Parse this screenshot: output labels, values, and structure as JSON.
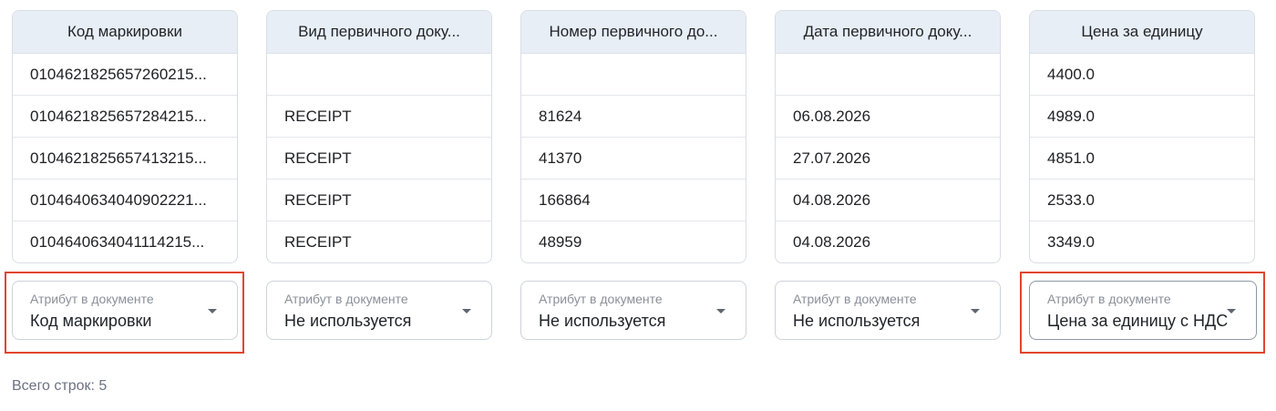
{
  "columns": [
    {
      "header": "Код маркировки",
      "cells": [
        "0104621825657260215...",
        "0104621825657284215...",
        "0104621825657413215...",
        "0104640634040902221...",
        "0104640634041114215..."
      ],
      "select": {
        "label": "Атрибут в документе",
        "value": "Код маркировки"
      }
    },
    {
      "header": "Вид первичного доку...",
      "cells": [
        "",
        "RECEIPT",
        "RECEIPT",
        "RECEIPT",
        "RECEIPT"
      ],
      "select": {
        "label": "Атрибут в документе",
        "value": "Не используется"
      }
    },
    {
      "header": "Номер первичного до...",
      "cells": [
        "",
        "81624",
        "41370",
        "166864",
        "48959"
      ],
      "select": {
        "label": "Атрибут в документе",
        "value": "Не используется"
      }
    },
    {
      "header": "Дата первичного доку...",
      "cells": [
        "",
        "06.08.2026",
        "27.07.2026",
        "04.08.2026",
        "04.08.2026"
      ],
      "select": {
        "label": "Атрибут в документе",
        "value": "Не используется"
      }
    },
    {
      "header": "Цена за единицу",
      "cells": [
        "4400.0",
        "4989.0",
        "4851.0",
        "2533.0",
        "3349.0"
      ],
      "select": {
        "label": "Атрибут в документе",
        "value": "Цена за единицу с НДС"
      }
    }
  ],
  "footer": {
    "total_rows": "Всего строк: 5"
  },
  "colors": {
    "highlight": "#e0462e",
    "header_bg": "#e8eef5"
  }
}
